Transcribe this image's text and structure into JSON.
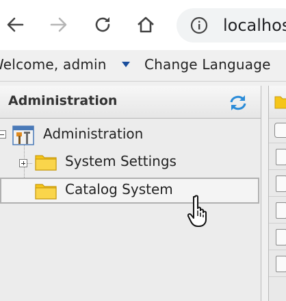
{
  "browser": {
    "address": "localhost",
    "icons": [
      "back-arrow-icon",
      "forward-arrow-icon",
      "reload-icon",
      "home-icon",
      "info-icon"
    ]
  },
  "header": {
    "welcome": "Welcome, admin",
    "change_language": "Change Language"
  },
  "panel": {
    "title": "Administration",
    "tree": [
      {
        "label": "Administration",
        "icon": "admin-tools-icon",
        "expanded": true
      },
      {
        "label": "System Settings",
        "icon": "folder-icon",
        "expanded": false
      },
      {
        "label": "Catalog System",
        "icon": "folder-icon",
        "selected": true
      }
    ]
  },
  "colors": {
    "folder": "#f5c518",
    "accent": "#1a4e9c",
    "refresh": "#2a8bd8"
  }
}
